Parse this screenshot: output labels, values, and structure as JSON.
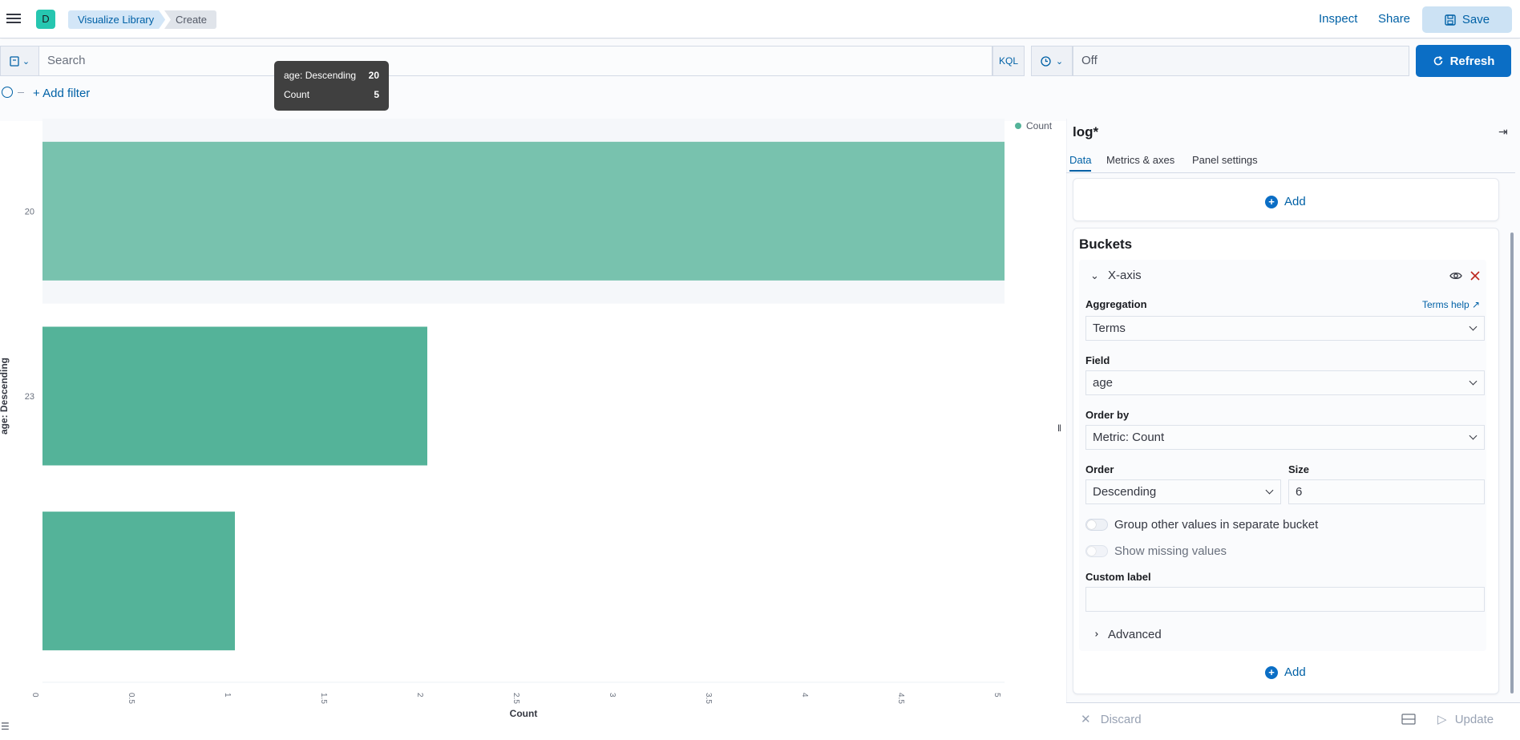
{
  "header": {
    "logo_letter": "D",
    "breadcrumbs": [
      "Visualize Library",
      "Create"
    ],
    "inspect_label": "Inspect",
    "share_label": "Share",
    "save_label": "Save"
  },
  "query": {
    "search_placeholder": "Search",
    "language": "KQL",
    "time_value": "Off",
    "refresh_label": "Refresh",
    "add_filter_label": "+ Add filter"
  },
  "tooltip": {
    "rows": [
      {
        "label": "age: Descending",
        "value": "20"
      },
      {
        "label": "Count",
        "value": "5"
      }
    ]
  },
  "chart_data": {
    "type": "bar",
    "orientation": "horizontal",
    "categories": [
      "20",
      "23",
      ""
    ],
    "series": [
      {
        "name": "Count",
        "values": [
          5,
          2,
          1
        ]
      }
    ],
    "xlabel": "Count",
    "ylabel": "age: Descending",
    "xlim": [
      0,
      5
    ],
    "x_ticks": [
      "0",
      "0.5",
      "1",
      "1.5",
      "2",
      "2.5",
      "3",
      "3.5",
      "4",
      "4.5",
      "5"
    ],
    "legend": "top-right",
    "color": "#54b399",
    "highlighted_category": "20"
  },
  "sidebar": {
    "title": "log*",
    "tabs": [
      "Data",
      "Metrics & axes",
      "Panel settings"
    ],
    "add_label": "Add",
    "buckets_title": "Buckets",
    "bucket": {
      "name": "X-axis",
      "aggregation_label": "Aggregation",
      "aggregation_help": "Terms help",
      "aggregation_value": "Terms",
      "field_label": "Field",
      "field_value": "age",
      "order_by_label": "Order by",
      "order_by_value": "Metric: Count",
      "order_label": "Order",
      "order_value": "Descending",
      "size_label": "Size",
      "size_value": "6",
      "group_other_label": "Group other values in separate bucket",
      "show_missing_label": "Show missing values",
      "custom_label_label": "Custom label",
      "custom_label_value": "",
      "advanced_label": "Advanced"
    },
    "discard_label": "Discard",
    "update_label": "Update"
  }
}
